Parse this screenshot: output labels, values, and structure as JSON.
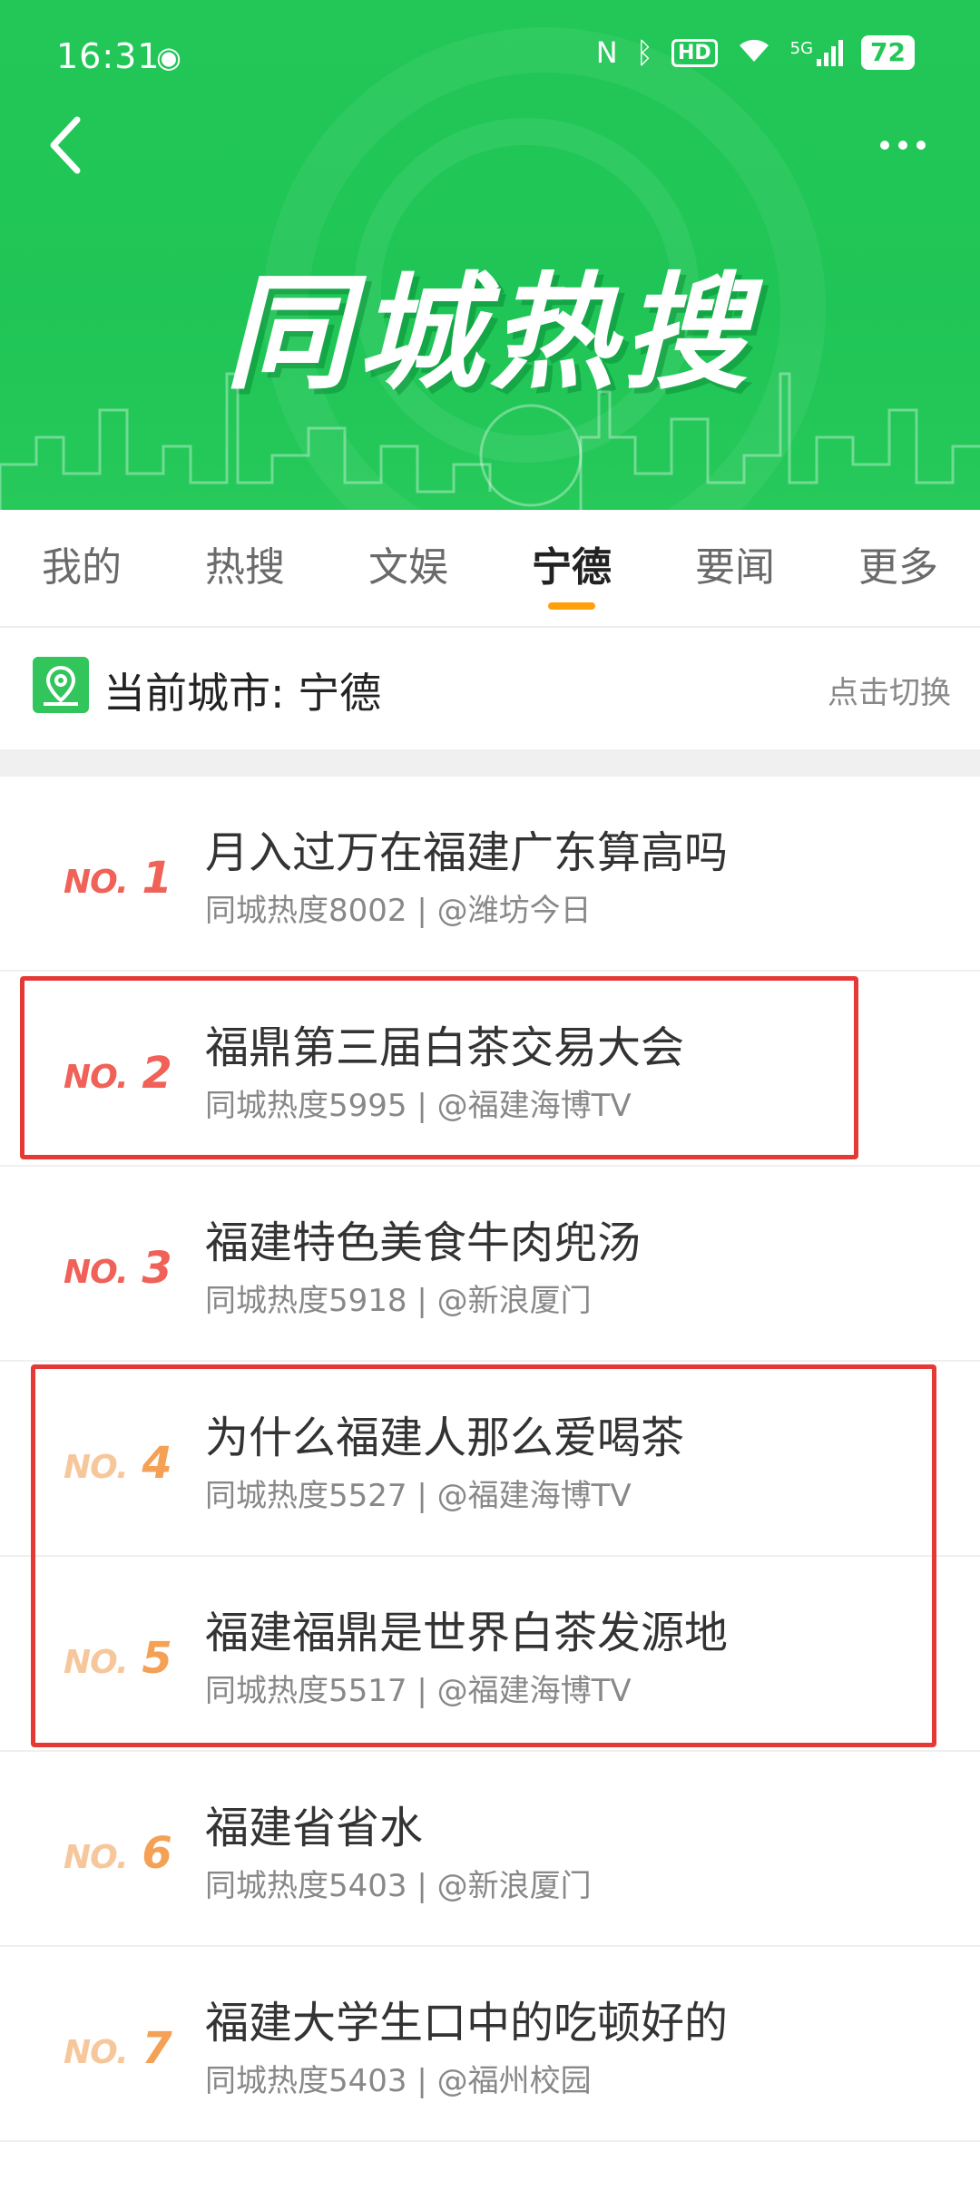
{
  "status": {
    "time": "16:31",
    "hd": "HD",
    "signal": "5G",
    "battery": "72"
  },
  "banner": {
    "title": "同城热搜"
  },
  "tabs": [
    {
      "label": "我的"
    },
    {
      "label": "热搜"
    },
    {
      "label": "文娱"
    },
    {
      "label": "宁德",
      "active": true
    },
    {
      "label": "要闻"
    },
    {
      "label": "更多"
    }
  ],
  "current_city": {
    "text": "当前城市: 宁德",
    "switch_label": "点击切换"
  },
  "items": [
    {
      "no": "NO.",
      "rank": "1",
      "title": "月入过万在福建广东算高吗",
      "meta": "同城热度8002 | @潍坊今日"
    },
    {
      "no": "NO.",
      "rank": "2",
      "title": "福鼎第三届白茶交易大会",
      "meta": "同城热度5995 | @福建海博TV"
    },
    {
      "no": "NO.",
      "rank": "3",
      "title": "福建特色美食牛肉兜汤",
      "meta": "同城热度5918 | @新浪厦门"
    },
    {
      "no": "NO.",
      "rank": "4",
      "title": "为什么福建人那么爱喝茶",
      "meta": "同城热度5527 | @福建海博TV"
    },
    {
      "no": "NO.",
      "rank": "5",
      "title": "福建福鼎是世界白茶发源地",
      "meta": "同城热度5517 | @福建海博TV"
    },
    {
      "no": "NO.",
      "rank": "6",
      "title": "福建省省水",
      "meta": "同城热度5403 | @新浪厦门"
    },
    {
      "no": "NO.",
      "rank": "7",
      "title": "福建大学生口中的吃顿好的",
      "meta": "同城热度5403 | @福州校园"
    }
  ],
  "colors": {
    "brand_green": "#22c757",
    "hot_rank": "#f06157",
    "warm_rank": "#f4a055",
    "tab_indicator": "#ff9f0a",
    "highlight_box": "#e53935"
  }
}
